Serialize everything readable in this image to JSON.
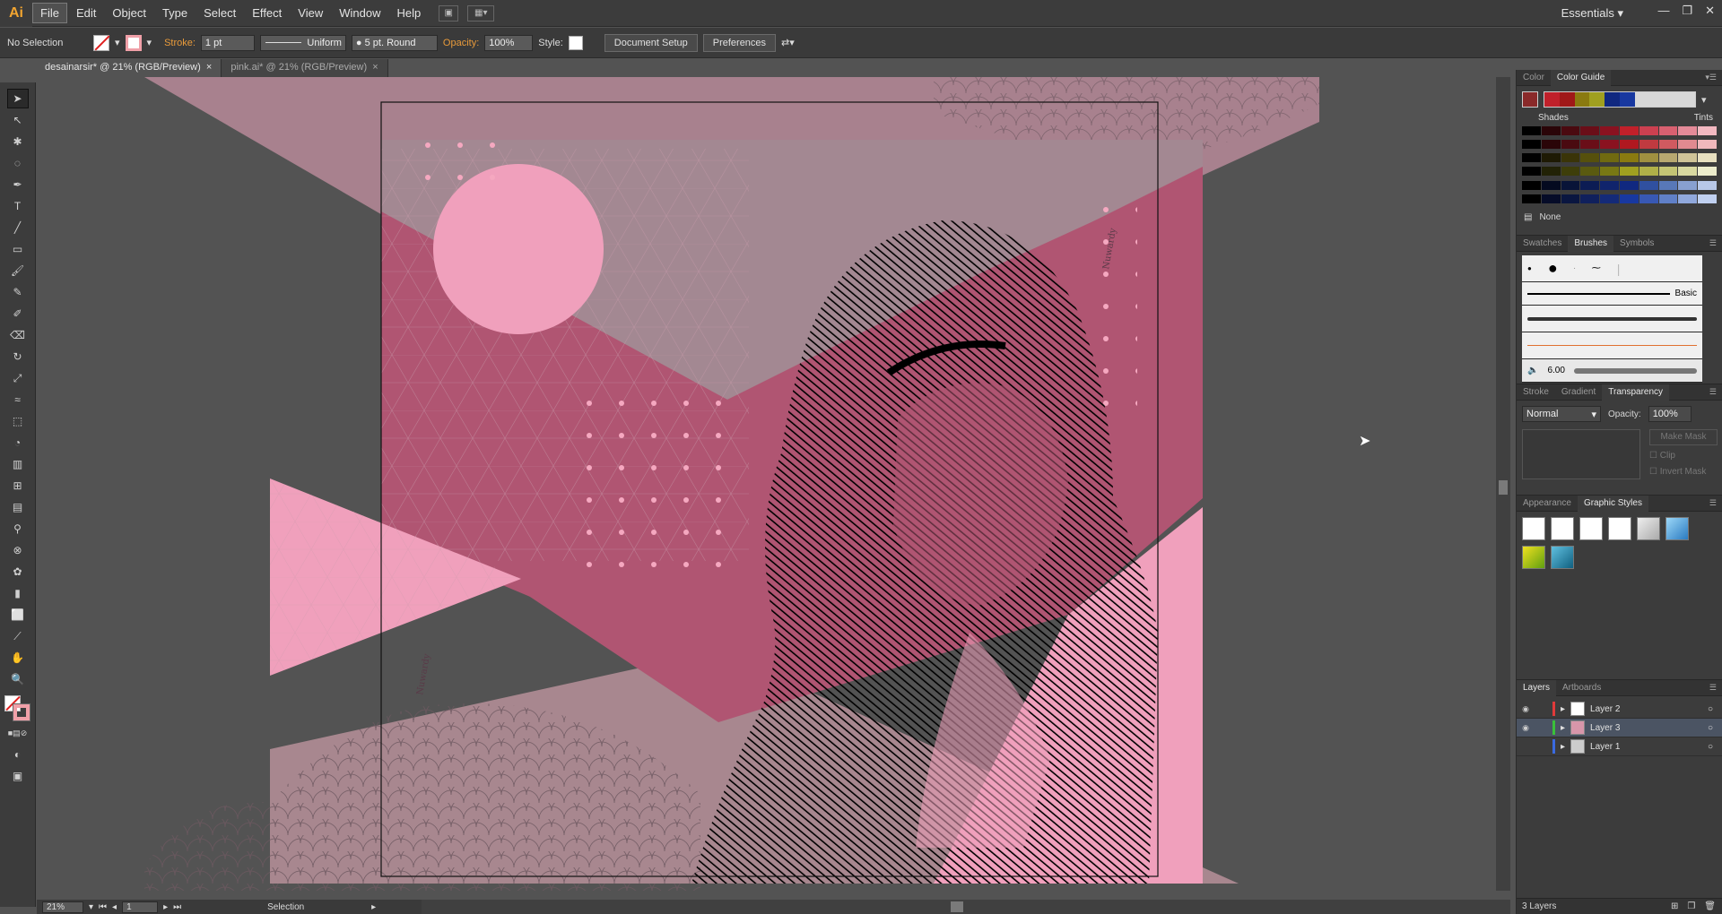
{
  "app": {
    "logo": "Ai",
    "workspace": "Essentials ▾"
  },
  "menu": [
    "File",
    "Edit",
    "Object",
    "Type",
    "Select",
    "Effect",
    "View",
    "Window",
    "Help"
  ],
  "control": {
    "selection": "No Selection",
    "stroke_label": "Stroke:",
    "stroke_value": "1 pt",
    "profile": "Uniform",
    "brush": "5 pt. Round",
    "opacity_label": "Opacity:",
    "opacity_value": "100%",
    "style_label": "Style:",
    "doc_setup": "Document Setup",
    "preferences": "Preferences"
  },
  "tabs": [
    {
      "label": "desainarsir* @ 21% (RGB/Preview)",
      "close": "×"
    },
    {
      "label": "pink.ai* @ 21% (RGB/Preview)",
      "close": "×"
    }
  ],
  "status": {
    "zoom": "21%",
    "page": "1",
    "tool": "Selection"
  },
  "panels": {
    "color_tabs": [
      "Color",
      "Color Guide"
    ],
    "shades": "Shades",
    "tints": "Tints",
    "none_label": "None",
    "brush_tabs": [
      "Swatches",
      "Brushes",
      "Symbols"
    ],
    "brush_basic": "Basic",
    "brush_size": "6.00",
    "transp_tabs": [
      "Stroke",
      "Gradient",
      "Transparency"
    ],
    "blend_mode": "Normal",
    "opacity_label": "Opacity:",
    "opacity_value": "100%",
    "make_mask": "Make Mask",
    "clip": "Clip",
    "invert_mask": "Invert Mask",
    "gs_tabs": [
      "Appearance",
      "Graphic Styles"
    ],
    "layers_tabs": [
      "Layers",
      "Artboards"
    ],
    "layers": [
      {
        "name": "Layer 2",
        "color": "#e03a3a",
        "visible": true
      },
      {
        "name": "Layer 3",
        "color": "#3ac03a",
        "visible": true
      },
      {
        "name": "Layer 1",
        "color": "#3a6ae0",
        "visible": false
      }
    ],
    "layers_count": "3 Layers"
  },
  "colors": {
    "accent_orange": "#f2a530",
    "pink_light": "#f0a0bc",
    "pink_dark": "#b05572",
    "mauve": "#a38892"
  }
}
